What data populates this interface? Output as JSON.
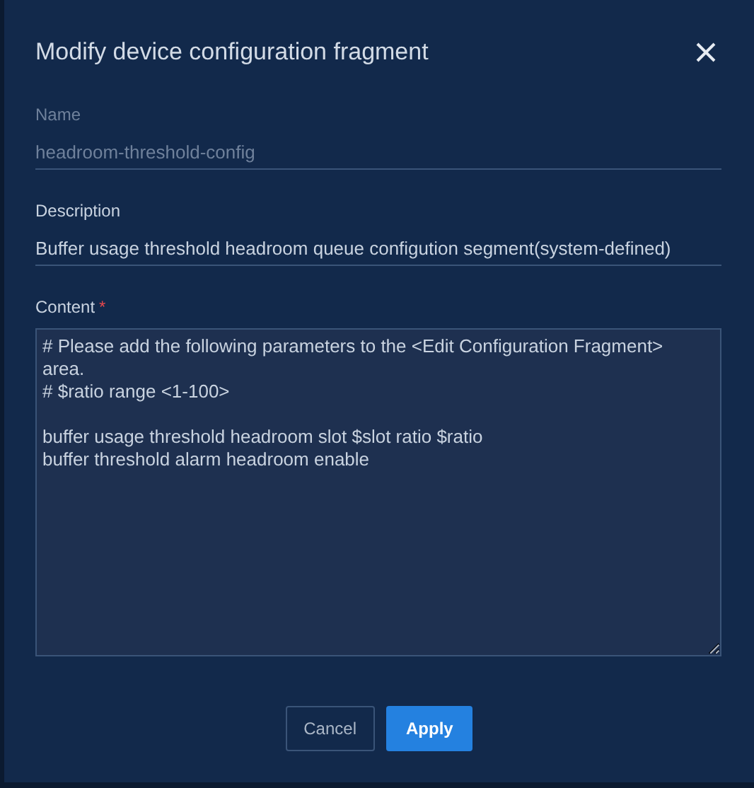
{
  "dialog": {
    "title": "Modify device configuration fragment"
  },
  "fields": [
    {
      "kind": "line",
      "label": "Name",
      "required": false,
      "disabled": true,
      "value": "headroom-threshold-config"
    },
    {
      "kind": "line",
      "label": "Description",
      "required": false,
      "disabled": false,
      "value": "Buffer usage threshold headroom queue configution segment(system-defined)"
    },
    {
      "kind": "area",
      "label": "Content",
      "required": true,
      "required_mark": "*",
      "disabled": false,
      "value": "# Please add the following parameters to the <Edit Configuration Fragment> area.\n# $ratio range <1-100>\n\nbuffer usage threshold headroom slot $slot ratio $ratio\nbuffer threshold alarm headroom enable"
    }
  ],
  "buttons": [
    {
      "label": "Cancel",
      "kind": "secondary"
    },
    {
      "label": "Apply",
      "kind": "primary"
    }
  ]
}
